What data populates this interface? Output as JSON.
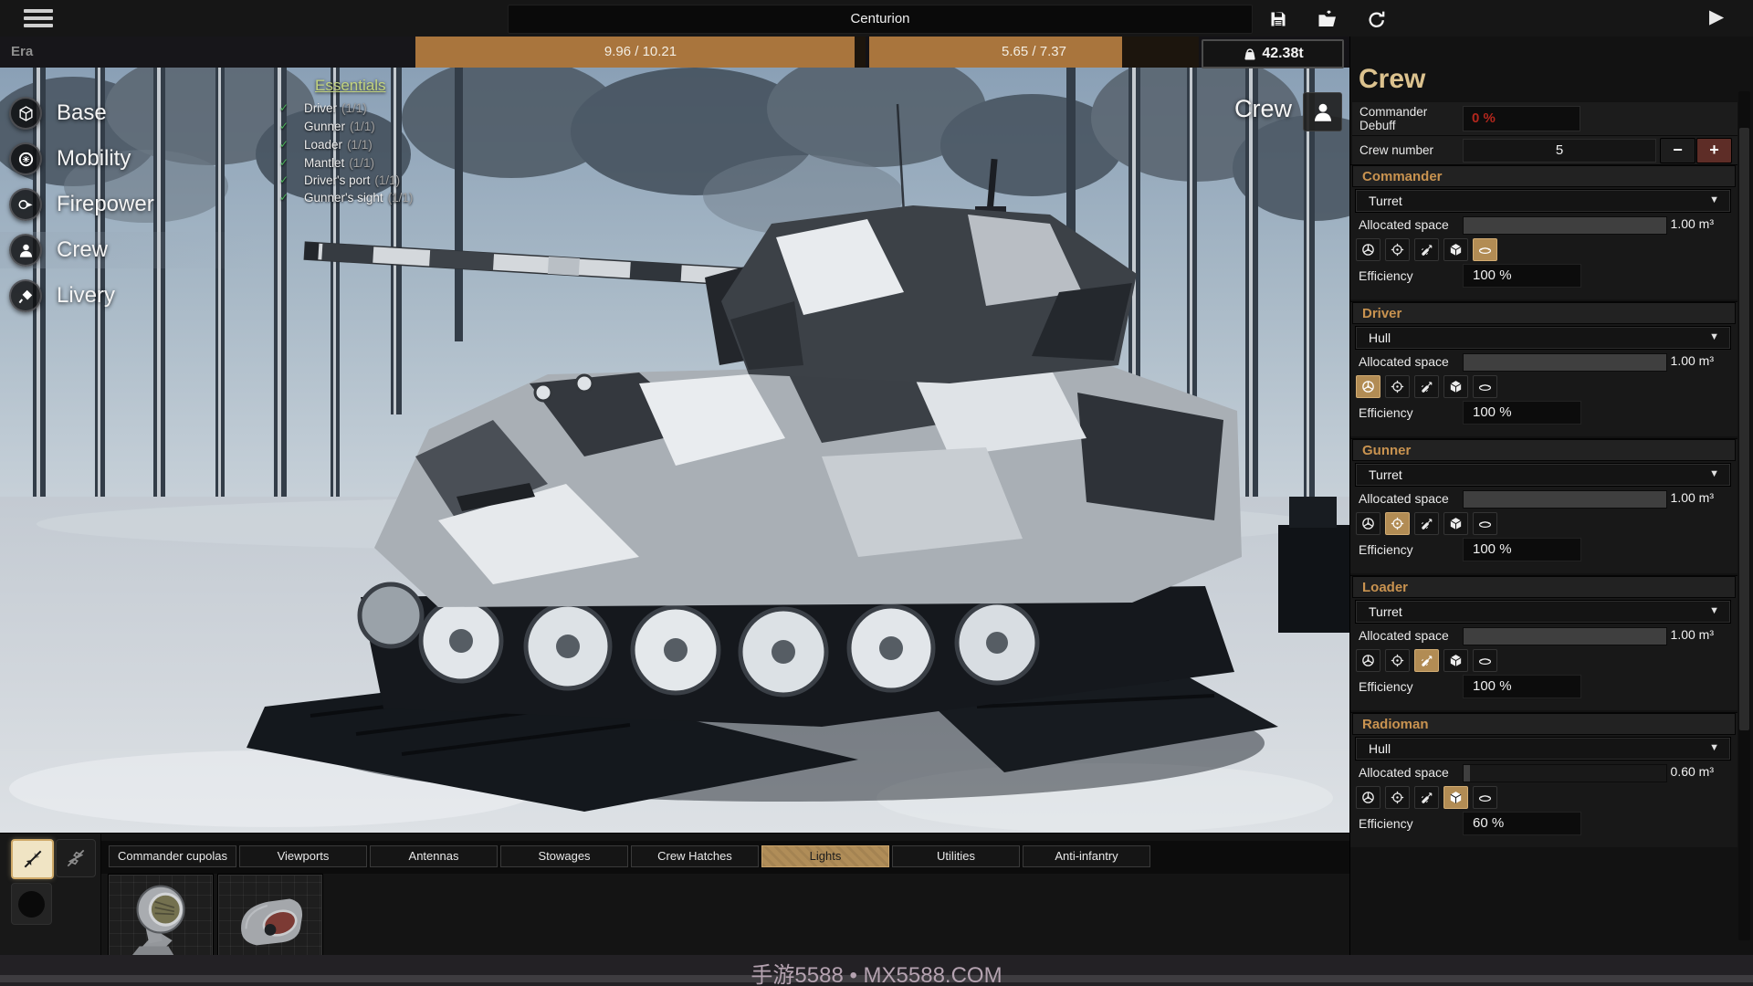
{
  "ui": {
    "caret": "▼",
    "check": "✓",
    "minus": "−",
    "plus": "+",
    "play": "▶"
  },
  "top_bar": {
    "title": "Centurion"
  },
  "era_bar": {
    "label": "Era",
    "capacity_bar": {
      "text": "9.96 / 10.21",
      "fill_pct": 97.6
    },
    "secondary_bar": {
      "text": "5.65 / 7.37",
      "fill_pct": 76.6
    },
    "weight": "42.38t"
  },
  "nav": {
    "items": [
      {
        "label": "Base",
        "icon": "cube-icon",
        "active": false
      },
      {
        "label": "Mobility",
        "icon": "gear-icon",
        "active": false
      },
      {
        "label": "Firepower",
        "icon": "shell-gun-icon",
        "active": false
      },
      {
        "label": "Crew",
        "icon": "person-icon",
        "active": true
      },
      {
        "label": "Livery",
        "icon": "paintbrush-icon",
        "active": false
      }
    ]
  },
  "essentials": {
    "title": "Essentials",
    "items": [
      {
        "name": "Driver",
        "count": "(1/1)"
      },
      {
        "name": "Gunner",
        "count": "(1/1)"
      },
      {
        "name": "Loader",
        "count": "(1/1)"
      },
      {
        "name": "Mantlet",
        "count": "(1/1)"
      },
      {
        "name": "Driver's port",
        "count": "(1/1)"
      },
      {
        "name": "Gunner's sight",
        "count": "(1/1)"
      }
    ]
  },
  "viewport": {
    "mode_label": "Crew"
  },
  "crew_panel": {
    "title": "Crew",
    "debuff_label_line1": "Commander",
    "debuff_label_line2": "Debuff",
    "debuff_value": "0 %",
    "crew_number_label": "Crew number",
    "crew_number_value": "5",
    "role_icons": [
      "steering-wheel",
      "crosshair",
      "shell",
      "cube",
      "beret"
    ],
    "sections": [
      {
        "name": "Commander",
        "location": "Turret",
        "allocated_label": "Allocated space",
        "allocated_value": "1.00 m³",
        "allocated_fill_pct": 100,
        "active_role": 4,
        "efficiency_label": "Efficiency",
        "efficiency_value": "100 %"
      },
      {
        "name": "Driver",
        "location": "Hull",
        "allocated_label": "Allocated space",
        "allocated_value": "1.00 m³",
        "allocated_fill_pct": 100,
        "active_role": 0,
        "efficiency_label": "Efficiency",
        "efficiency_value": "100 %"
      },
      {
        "name": "Gunner",
        "location": "Turret",
        "allocated_label": "Allocated space",
        "allocated_value": "1.00 m³",
        "allocated_fill_pct": 100,
        "active_role": 1,
        "efficiency_label": "Efficiency",
        "efficiency_value": "100 %"
      },
      {
        "name": "Loader",
        "location": "Turret",
        "allocated_label": "Allocated space",
        "allocated_value": "1.00 m³",
        "allocated_fill_pct": 100,
        "active_role": 2,
        "efficiency_label": "Efficiency",
        "efficiency_value": "100 %"
      },
      {
        "name": "Radioman",
        "location": "Hull",
        "allocated_label": "Allocated space",
        "allocated_value": "0.60 m³",
        "allocated_fill_pct": 3,
        "active_role": 3,
        "efficiency_label": "Efficiency",
        "efficiency_value": "60 %"
      }
    ]
  },
  "bottom_bar": {
    "tabs": [
      {
        "label": "Commander cupolas",
        "selected": false
      },
      {
        "label": "Viewports",
        "selected": false
      },
      {
        "label": "Antennas",
        "selected": false
      },
      {
        "label": "Stowages",
        "selected": false
      },
      {
        "label": "Crew Hatches",
        "selected": false
      },
      {
        "label": "Lights",
        "selected": true
      },
      {
        "label": "Utilities",
        "selected": false
      },
      {
        "label": "Anti-infantry",
        "selected": false
      }
    ],
    "tools": [
      {
        "name": "mirror-toggle",
        "selected": true
      },
      {
        "name": "mirror-axis-toggle",
        "selected": false
      },
      {
        "name": "color-swatch",
        "selected": false
      }
    ],
    "items": [
      {
        "name": "headlight"
      },
      {
        "name": "tail-light"
      }
    ]
  },
  "watermark": "手游5588 • MX5588.COM",
  "colors": {
    "accent_tan": "#a9753d",
    "selected_tab": "#b08d58",
    "panel_title_gold": "#dcc28e",
    "section_header_orange": "#c99350",
    "debuff_red": "#b3271d",
    "essentials_green": "#c3d47e",
    "check_green": "#4db45c",
    "plus_button": "#5e2d27"
  }
}
